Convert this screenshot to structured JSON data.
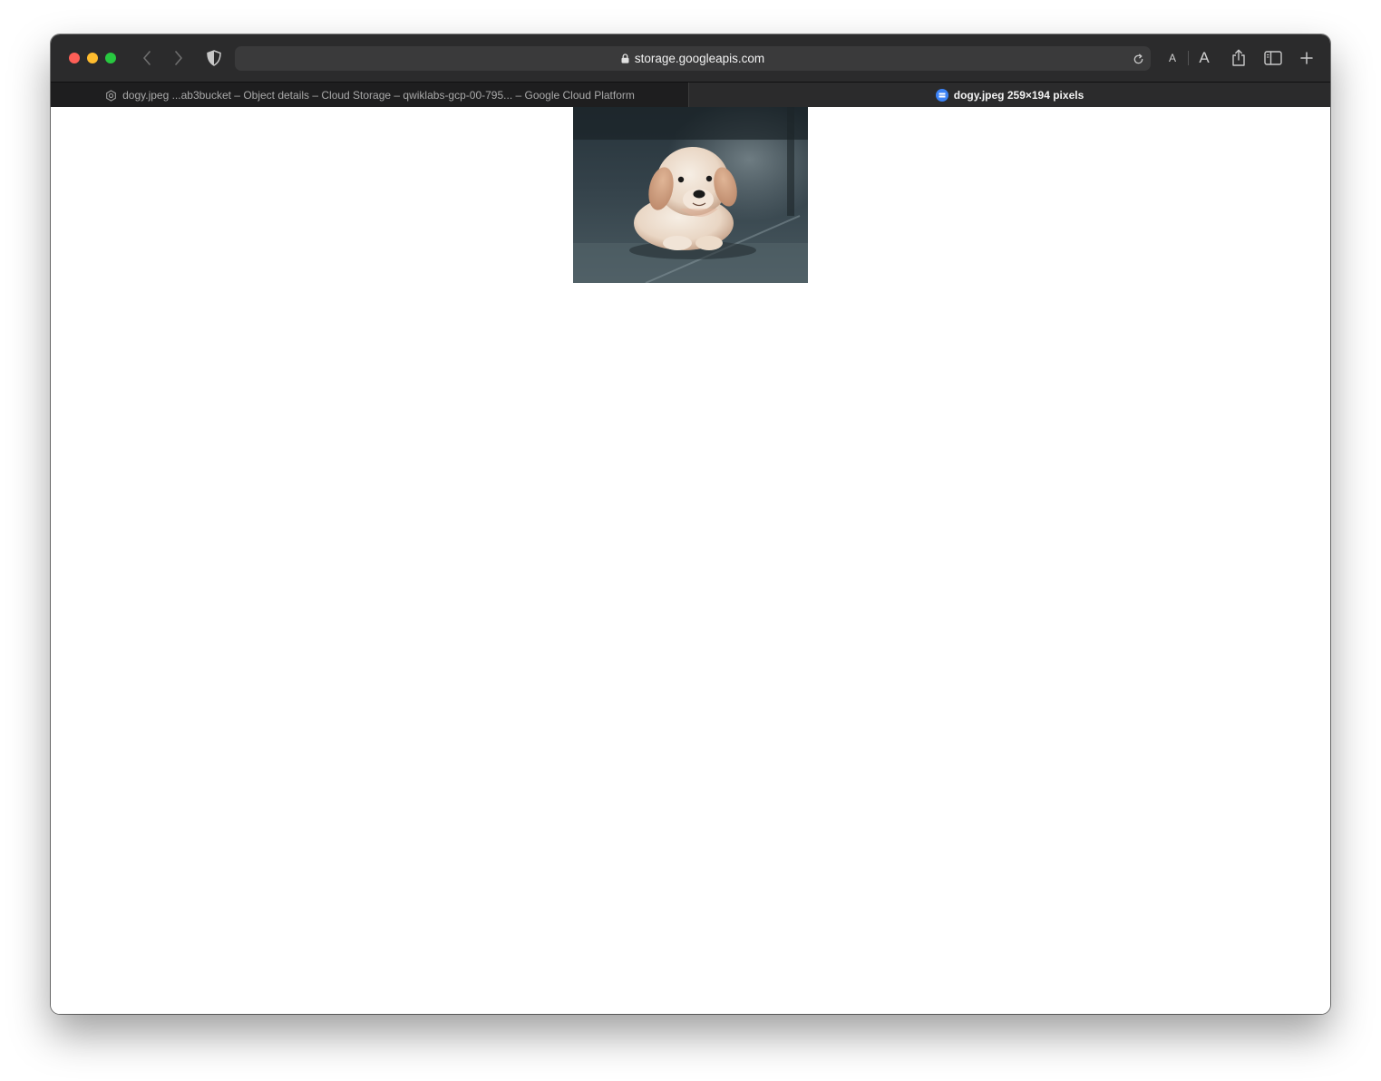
{
  "browser": {
    "address": "storage.googleapis.com",
    "reader_small_label": "A",
    "reader_large_label": "A"
  },
  "tabs": [
    {
      "title": "dogy.jpeg ...ab3bucket – Object details – Cloud Storage – qwiklabs-gcp-00-795... – Google Cloud Platform",
      "active": false
    },
    {
      "title": "dogy.jpeg 259×194 pixels",
      "active": true
    }
  ],
  "content": {
    "image_name": "dogy.jpeg",
    "image_subject": "puppy-photo"
  },
  "colors": {
    "toolbar": "#2b2b2c",
    "tabbar": "#1e1e1f",
    "address_field": "#3a3a3b",
    "favicon_active": "#3b82f6"
  }
}
